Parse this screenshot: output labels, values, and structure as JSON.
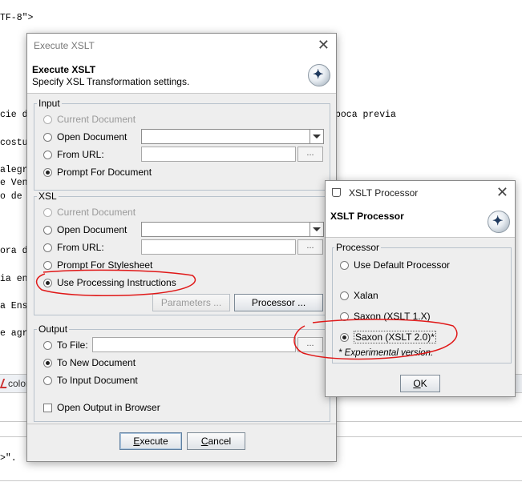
{
  "background": {
    "lines": [
      "TF-8\">",
      "cie de",
      "poca previa",
      "costu",
      "alegr",
      "e Vene",
      "o de a",
      "ora de",
      "ia enc",
      "a Ense",
      "e agre",
      ">\"."
    ],
    "tab_label": "color",
    "colors": {
      "editor_bg": "#ffffff",
      "accent": "#5f7fa0"
    }
  },
  "execute_dialog": {
    "title": "Execute XSLT",
    "header_title": "Execute XSLT",
    "header_subtitle": "Specify XSL Transformation settings.",
    "logo_icon": "compass-star-icon",
    "input": {
      "label": "Input",
      "current_document": "Current Document",
      "open_document": "Open Document",
      "from_url": "From URL:",
      "prompt_for_document": "Prompt For Document",
      "ellipsis": "...",
      "selected": "Prompt For Document"
    },
    "xsl": {
      "label": "XSL",
      "current_document": "Current Document",
      "open_document": "Open Document",
      "from_url": "From URL:",
      "prompt_for_stylesheet": "Prompt For Stylesheet",
      "use_processing_instructions": "Use Processing Instructions",
      "ellipsis": "...",
      "parameters_button": "Parameters ...",
      "processor_button": "Processor ...",
      "selected": "Use Processing Instructions"
    },
    "output": {
      "label": "Output",
      "to_file": "To File:",
      "to_new_document": "To New Document",
      "to_input_document": "To Input Document",
      "open_output_in_browser": "Open Output in Browser",
      "ellipsis": "...",
      "selected": "To New Document",
      "open_in_browser_checked": false
    },
    "buttons": {
      "execute_rest": "xecute",
      "execute_mnemonic": "E",
      "cancel_rest": "ancel",
      "cancel_mnemonic": "C"
    }
  },
  "processor_dialog": {
    "title": "XSLT Processor",
    "header_title": "XSLT Processor",
    "logo_icon": "compass-star-icon",
    "processor": {
      "label": "Processor",
      "use_default": "Use Default Processor",
      "xalan": "Xalan",
      "saxon1": "Saxon (XSLT 1.X)",
      "saxon2": "Saxon (XSLT 2.0)*",
      "note": "* Experimental version.",
      "selected": "Saxon (XSLT 2.0)*"
    },
    "ok_rest": "K",
    "ok_mnemonic": "O"
  }
}
